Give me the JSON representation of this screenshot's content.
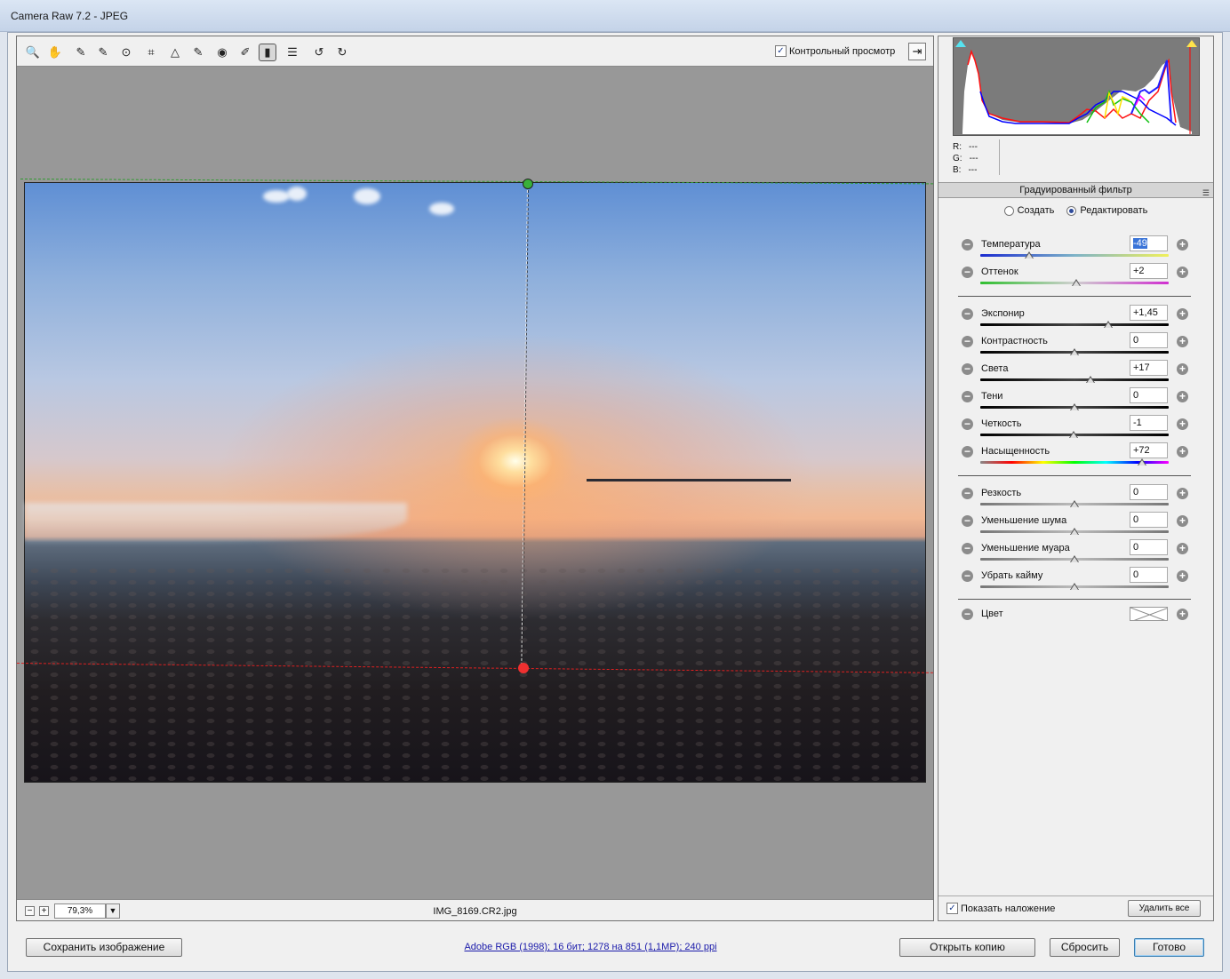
{
  "window": {
    "title": "Camera Raw 7.2  -  JPEG"
  },
  "toolbar": {
    "tools": [
      {
        "name": "zoom-tool",
        "glyph": "🔍"
      },
      {
        "name": "hand-tool",
        "glyph": "✋"
      },
      {
        "name": "white-balance-tool",
        "glyph": "✎"
      },
      {
        "name": "color-sampler-tool",
        "glyph": "✎"
      },
      {
        "name": "targeted-adjustment-tool",
        "glyph": "⊙"
      },
      {
        "name": "crop-tool",
        "glyph": "⌗"
      },
      {
        "name": "straighten-tool",
        "glyph": "△"
      },
      {
        "name": "spot-removal-tool",
        "glyph": "✎"
      },
      {
        "name": "red-eye-tool",
        "glyph": "◉"
      },
      {
        "name": "adjustment-brush-tool",
        "glyph": "✐"
      },
      {
        "name": "graduated-filter-tool",
        "glyph": "▮"
      },
      {
        "name": "preferences-tool",
        "glyph": "☰"
      },
      {
        "name": "rotate-left-tool",
        "glyph": "↺"
      },
      {
        "name": "rotate-right-tool",
        "glyph": "↻"
      }
    ],
    "preview_label": "Контрольный просмотр",
    "preview_checked": true
  },
  "status": {
    "zoom": "79,3%",
    "filename": "IMG_8169.CR2.jpg"
  },
  "panel": {
    "title": "Градуированный фильтр",
    "mode_create": "Создать",
    "mode_edit": "Редактировать",
    "sliders": [
      {
        "label": "Температура",
        "value": "-49",
        "position": 0.26,
        "track": "temperature",
        "selected": true
      },
      {
        "label": "Оттенок",
        "value": "+2",
        "position": 0.51,
        "track": "tint"
      },
      {
        "label": "Экспонир",
        "value": "+1,45",
        "position": 0.68,
        "track": "dark"
      },
      {
        "label": "Контрастность",
        "value": "0",
        "position": 0.5,
        "track": "dark"
      },
      {
        "label": "Света",
        "value": "+17",
        "position": 0.585,
        "track": "dark"
      },
      {
        "label": "Тени",
        "value": "0",
        "position": 0.5,
        "track": "dark"
      },
      {
        "label": "Четкость",
        "value": "-1",
        "position": 0.495,
        "track": "dark"
      },
      {
        "label": "Насыщенность",
        "value": "+72",
        "position": 0.86,
        "track": "saturation"
      },
      {
        "label": "Резкость",
        "value": "0",
        "position": 0.5,
        "track": "gray"
      },
      {
        "label": "Уменьшение шума",
        "value": "0",
        "position": 0.5,
        "track": "gray"
      },
      {
        "label": "Уменьшение муара",
        "value": "0",
        "position": 0.5,
        "track": "gray"
      },
      {
        "label": "Убрать кайму",
        "value": "0",
        "position": 0.5,
        "track": "gray"
      }
    ],
    "color_label": "Цвет",
    "overlay_label": "Показать наложение",
    "overlay_checked": true,
    "delete_all": "Удалить все"
  },
  "readout": {
    "r_label": "R:",
    "r": "---",
    "g_label": "G:",
    "g": "---",
    "b_label": "B:",
    "b": "---"
  },
  "footer": {
    "save": "Сохранить изображение",
    "info": "Adobe RGB (1998); 16 бит; 1278 на 851 (1,1MP); 240 ppi",
    "open_copy": "Открыть копию",
    "reset": "Сбросить",
    "done": "Готово"
  },
  "colors": {
    "accent": "#3a74d8",
    "start_pin": "#39b039",
    "end_pin": "#ef3030",
    "link": "#1a1aaa"
  }
}
